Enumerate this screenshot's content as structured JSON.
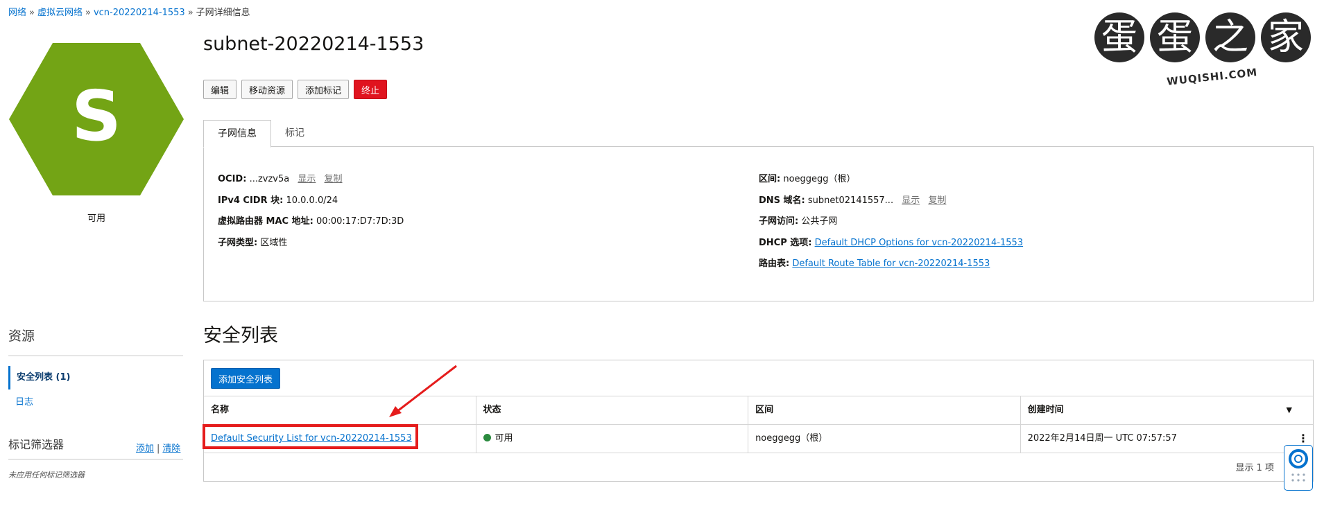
{
  "breadcrumb": {
    "items": [
      "网络",
      "虚拟云网络",
      "vcn-20220214-1553"
    ],
    "current": "子网详细信息",
    "separator": "»"
  },
  "avatar": {
    "letter": "S",
    "status": "可用",
    "color": "#73a415"
  },
  "logo": {
    "chars": [
      "蛋",
      "蛋",
      "之",
      "家"
    ],
    "sub": "WUQISHI.COM"
  },
  "header": {
    "title": "subnet-20220214-1553"
  },
  "actions": {
    "edit": "编辑",
    "move": "移动资源",
    "add_tag": "添加标记",
    "terminate": "终止"
  },
  "tabs": {
    "info": "子网信息",
    "tags": "标记"
  },
  "info": {
    "ocid_label": "OCID:",
    "ocid_value": "...zvzv5a",
    "show": "显示",
    "copy": "复制",
    "cidr_label": "IPv4 CIDR 块:",
    "cidr_value": "10.0.0.0/24",
    "mac_label": "虚拟路由器 MAC 地址:",
    "mac_value": "00:00:17:D7:7D:3D",
    "type_label": "子网类型:",
    "type_value": "区域性",
    "region_label": "区间:",
    "region_value": "noeggegg（根）",
    "dns_label": "DNS 域名:",
    "dns_value": "subnet02141557...",
    "access_label": "子网访问:",
    "access_value": "公共子网",
    "dhcp_label": "DHCP 选项:",
    "dhcp_value": "Default DHCP Options for vcn-20220214-1553",
    "route_label": "路由表:",
    "route_value": "Default Route Table for vcn-20220214-1553"
  },
  "sidebar": {
    "resources_title": "资源",
    "items": [
      {
        "label": "安全列表 (1)",
        "active": true
      },
      {
        "label": "日志",
        "active": false
      }
    ],
    "filter_title": "标记筛选器",
    "filter_add": "添加",
    "filter_sep": "|",
    "filter_clear": "清除",
    "filter_empty": "未应用任何标记筛选器"
  },
  "security_lists": {
    "title": "安全列表",
    "add_button": "添加安全列表",
    "columns": [
      "名称",
      "状态",
      "区间",
      "创建时间"
    ],
    "rows": [
      {
        "name": "Default Security List for vcn-20220214-1553",
        "status": "可用",
        "compartment": "noeggegg（根）",
        "created": "2022年2月14日周一 UTC 07:57:57"
      }
    ],
    "pager": "显示 1 项"
  },
  "colors": {
    "accent": "#0572ce",
    "danger": "#e0141f",
    "available": "#2a8a3e",
    "annotation": "#e51c1c"
  }
}
